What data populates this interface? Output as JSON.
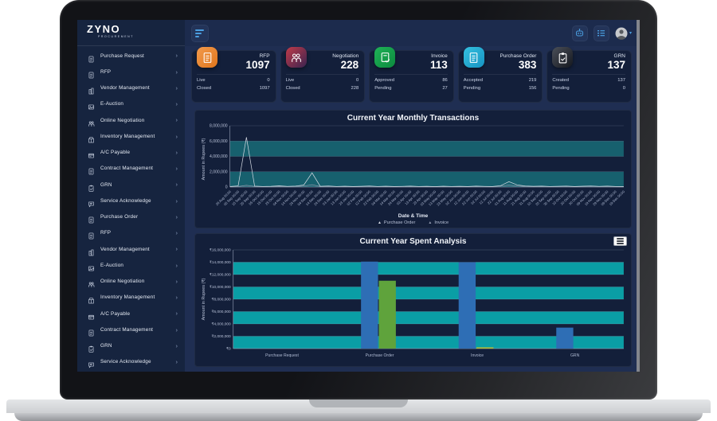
{
  "brand": {
    "name": "ZYNO",
    "tagline": "PROCUREMENT"
  },
  "topbar": {
    "hamburger_icon": "hamburger-menu",
    "icons": [
      {
        "name": "chatbot-icon"
      },
      {
        "name": "task-list-icon"
      }
    ],
    "user_caret": "▾"
  },
  "sidebar": {
    "items": [
      {
        "label": "Purchase Request",
        "icon": "purchase-request-icon",
        "glyph": "doc",
        "chevron": "›"
      },
      {
        "label": "RFP",
        "icon": "rfp-icon",
        "glyph": "doc",
        "chevron": "›"
      },
      {
        "label": "Vendor Management",
        "icon": "vendor-management-icon",
        "glyph": "building",
        "chevron": "›"
      },
      {
        "label": "E-Auction",
        "icon": "e-auction-icon",
        "glyph": "image",
        "chevron": "›"
      },
      {
        "label": "Online Negotiation",
        "icon": "online-negotiation-icon",
        "glyph": "people",
        "chevron": "›"
      },
      {
        "label": "Inventory Management",
        "icon": "inventory-management-icon",
        "glyph": "box",
        "chevron": "›"
      },
      {
        "label": "A/C Payable",
        "icon": "ac-payable-icon",
        "glyph": "card",
        "chevron": "›"
      },
      {
        "label": "Contract Management",
        "icon": "contract-management-icon",
        "glyph": "doc",
        "chevron": "›"
      },
      {
        "label": "GRN",
        "icon": "grn-icon",
        "glyph": "clipboard",
        "chevron": "›"
      },
      {
        "label": "Service Acknowledge",
        "icon": "service-acknowledge-icon",
        "glyph": "chat",
        "chevron": "›"
      },
      {
        "label": "Purchase Order",
        "icon": "purchase-order-icon",
        "glyph": "doc",
        "chevron": "›"
      },
      {
        "label": "RFP",
        "icon": "rfp-icon",
        "glyph": "doc",
        "chevron": "›"
      },
      {
        "label": "Vendor Management",
        "icon": "vendor-management-icon",
        "glyph": "building",
        "chevron": "›"
      },
      {
        "label": "E-Auction",
        "icon": "e-auction-icon",
        "glyph": "image",
        "chevron": "›"
      },
      {
        "label": "Online Negotiation",
        "icon": "online-negotiation-icon",
        "glyph": "people",
        "chevron": "›"
      },
      {
        "label": "Inventory Management",
        "icon": "inventory-management-icon",
        "glyph": "box",
        "chevron": "›"
      },
      {
        "label": "A/C Payable",
        "icon": "ac-payable-icon",
        "glyph": "card",
        "chevron": "›"
      },
      {
        "label": "Contract Management",
        "icon": "contract-management-icon",
        "glyph": "doc",
        "chevron": "›"
      },
      {
        "label": "GRN",
        "icon": "grn-icon",
        "glyph": "clipboard",
        "chevron": "›"
      },
      {
        "label": "Service Acknowledge",
        "icon": "service-acknowledge-icon",
        "glyph": "chat",
        "chevron": "›"
      }
    ]
  },
  "kpi_cards": [
    {
      "title": "RFP",
      "value": "1097",
      "icon": "rfp-card-icon",
      "glyph": "doc",
      "icon_colors": [
        "#f29a4c",
        "#e0761c"
      ],
      "rows": [
        {
          "label": "Live",
          "value": "0"
        },
        {
          "label": "Closed",
          "value": "1097"
        }
      ]
    },
    {
      "title": "Negotiation",
      "value": "228",
      "icon": "negotiation-card-icon",
      "glyph": "people",
      "icon_colors": [
        "#c13b49",
        "#3a2350"
      ],
      "rows": [
        {
          "label": "Live",
          "value": "0"
        },
        {
          "label": "Closed",
          "value": "228"
        }
      ]
    },
    {
      "title": "Invoice",
      "value": "113",
      "icon": "invoice-card-icon",
      "glyph": "doccheck",
      "icon_colors": [
        "#1fb257",
        "#0c8a3e"
      ],
      "rows": [
        {
          "label": "Approved",
          "value": "86"
        },
        {
          "label": "Pending",
          "value": "27"
        }
      ]
    },
    {
      "title": "Purchase Order",
      "value": "383",
      "icon": "purchase-order-card-icon",
      "glyph": "doc",
      "icon_colors": [
        "#35c1e0",
        "#1693c1"
      ],
      "rows": [
        {
          "label": "Accepted",
          "value": "219"
        },
        {
          "label": "Pending",
          "value": "156"
        }
      ]
    },
    {
      "title": "GRN",
      "value": "137",
      "icon": "grn-card-icon",
      "glyph": "clipboard",
      "icon_colors": [
        "#4a4f58",
        "#15181f"
      ],
      "rows": [
        {
          "label": "Created",
          "value": "137"
        },
        {
          "label": "Pending",
          "value": "0"
        }
      ]
    }
  ],
  "chart_data": [
    {
      "type": "line",
      "title": "Current Year Monthly Transactions",
      "xlabel": "Date & Time",
      "ylabel": "Amount in Rupees (₹)",
      "ylim": [
        0,
        8000000
      ],
      "yticks": [
        "8,000,000",
        "6,000,000",
        "4,000,000",
        "2,000,000",
        "0"
      ],
      "ytick_values": [
        8000000,
        6000000,
        4000000,
        2000000,
        0
      ],
      "stripe_bands": [
        [
          0,
          2000000
        ],
        [
          4000000,
          6000000
        ]
      ],
      "stripe_color": "#17606e",
      "grid": true,
      "legend_position": "bottom",
      "x": [
        "26 Aug 00:00",
        "05 Sep 00:00",
        "15 Sep 00:00",
        "25 Sep 00:00",
        "05 Oct 00:00",
        "15 Oct 00:00",
        "25 Oct 00:00",
        "04 Nov 00:00",
        "14 Nov 00:00",
        "24 Nov 00:00",
        "04 Dec 00:00",
        "14 Dec 00:00",
        "24 Dec 00:00",
        "03 Jan 00:00",
        "13 Jan 00:00",
        "23 Jan 00:00",
        "02 Feb 00:00",
        "12 Feb 00:00",
        "22 Feb 00:00",
        "04 Mar 00:00",
        "14 Mar 00:00",
        "24 Mar 00:00",
        "03 Apr 00:00",
        "13 Apr 00:00",
        "23 Apr 00:00",
        "03 May 00:00",
        "13 May 00:00",
        "23 May 00:00",
        "02 Jun 00:00",
        "12 Jun 00:00",
        "22 Jun 00:00",
        "02 Jul 00:00",
        "12 Jul 00:00",
        "22 Jul 00:00",
        "01 Aug 00:00",
        "11 Aug 00:00",
        "21 Aug 00:00",
        "31 Aug 00:00",
        "10 Sep 00:00",
        "20 Sep 00:00",
        "30 Sep 00:00",
        "10 Oct 00:00",
        "20 Oct 00:00",
        "30 Oct 00:00",
        "09 Nov 00:00",
        "19 Nov 00:00",
        "29 Nov 00:00",
        "09 Dec 00:00",
        "19 Dec 00:00"
      ],
      "series": [
        {
          "name": "Purchase Order",
          "marker": "▲",
          "color": "#d6dbe4",
          "values": [
            60000,
            150000,
            6500000,
            120000,
            70000,
            90000,
            160000,
            80000,
            120000,
            260000,
            1850000,
            90000,
            140000,
            70000,
            100000,
            60000,
            90000,
            130000,
            70000,
            100000,
            60000,
            80000,
            110000,
            70000,
            90000,
            50000,
            100000,
            70000,
            90000,
            60000,
            110000,
            80000,
            60000,
            180000,
            700000,
            280000,
            130000,
            90000,
            110000,
            70000,
            90000,
            120000,
            60000,
            100000,
            140000,
            80000,
            110000,
            70000,
            50000
          ]
        },
        {
          "name": "Invoice",
          "marker": "▲",
          "color": "#8f98ab",
          "values": [
            30000,
            60000,
            220000,
            80000,
            50000,
            70000,
            90000,
            60000,
            80000,
            120000,
            300000,
            70000,
            90000,
            50000,
            70000,
            40000,
            60000,
            80000,
            50000,
            70000,
            40000,
            60000,
            80000,
            50000,
            60000,
            40000,
            70000,
            50000,
            60000,
            40000,
            80000,
            60000,
            50000,
            120000,
            250000,
            140000,
            90000,
            60000,
            80000,
            50000,
            70000,
            90000,
            40000,
            70000,
            100000,
            60000,
            80000,
            50000,
            40000
          ]
        }
      ]
    },
    {
      "type": "bar",
      "title": "Current Year Spent Analysis",
      "xlabel": "",
      "ylabel": "Amount in Rupees (₹)",
      "ylim": [
        0,
        16000000
      ],
      "yticks": [
        "₹16,000,000",
        "₹14,000,000",
        "₹12,000,000",
        "₹10,000,000",
        "₹8,000,000",
        "₹6,000,000",
        "₹4,000,000",
        "₹2,000,000",
        "₹0"
      ],
      "ytick_values": [
        16000000,
        14000000,
        12000000,
        10000000,
        8000000,
        6000000,
        4000000,
        2000000,
        0
      ],
      "stripe_bands": [
        [
          0,
          2000000
        ],
        [
          4000000,
          6000000
        ],
        [
          8000000,
          10000000
        ],
        [
          12000000,
          14000000
        ]
      ],
      "stripe_color": "#0a9ea5",
      "grid": true,
      "menu_icon": "hamburger-menu",
      "categories": [
        "Purchase Request",
        "Purchase Order",
        "Invoice",
        "GRN"
      ],
      "bars": [
        {
          "category": "Purchase Request",
          "segments": []
        },
        {
          "category": "Purchase Order",
          "segments": [
            {
              "value": 14100000,
              "color": "#2e6eb5"
            },
            {
              "value": 11000000,
              "color": "#5fa33c"
            }
          ]
        },
        {
          "category": "Invoice",
          "segments": [
            {
              "value": 14000000,
              "color": "#2e6eb5"
            },
            {
              "value": 200000,
              "color": "#b7bd33"
            }
          ]
        },
        {
          "category": "GRN",
          "segments": [
            {
              "value": 3400000,
              "color": "#2e6eb5"
            }
          ]
        }
      ]
    }
  ],
  "colors": {
    "accent_blue": "#4a9ee0",
    "sidebar_bg": "#16243f",
    "main_bg": "#1f2e52",
    "panel_bg": "#131f3a",
    "line_stripe_teal": "#17606e",
    "bar_stripe_teal": "#0a9ea5",
    "bar_blue": "#2e6eb5",
    "bar_green": "#5fa33c",
    "bar_yellow": "#b7bd33"
  }
}
